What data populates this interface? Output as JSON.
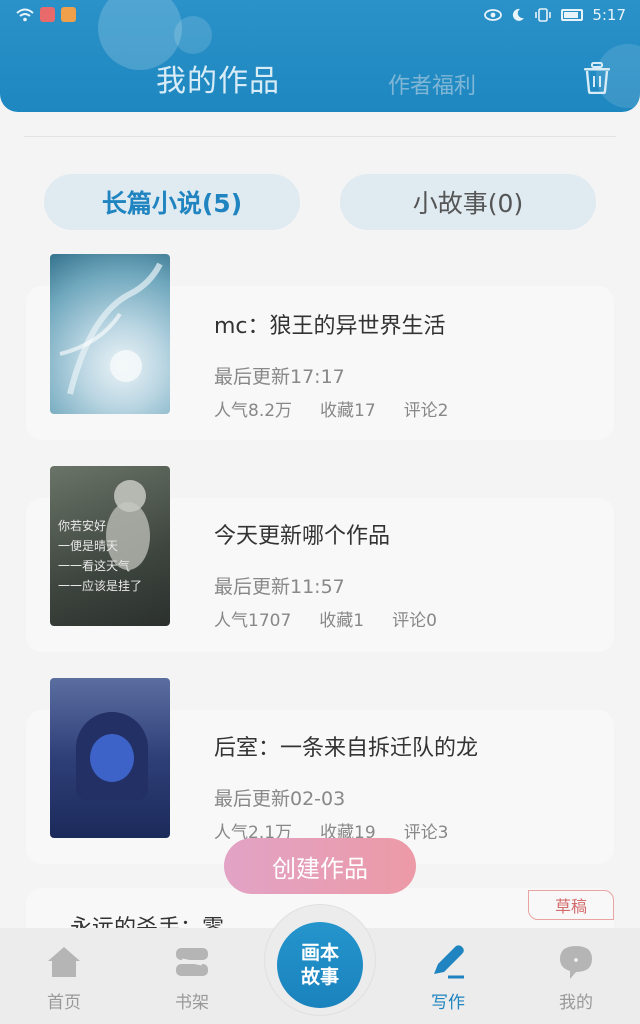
{
  "status_bar": {
    "time": "5:17"
  },
  "header": {
    "tab_my_works": "我的作品",
    "tab_author_welfare": "作者福利"
  },
  "segments": {
    "novel": "长篇小说(5)",
    "story": "小故事(0)"
  },
  "works": [
    {
      "title": "mc：狼王的异世界生活",
      "updated": "最后更新17:17",
      "popularity": "人气8.2万",
      "favorites": "收藏17",
      "comments": "评论2"
    },
    {
      "title": "今天更新哪个作品",
      "updated": "最后更新11:57",
      "popularity": "人气1707",
      "favorites": "收藏1",
      "comments": "评论0"
    },
    {
      "title": "后室：一条来自拆迁队的龙",
      "updated": "最后更新02-03",
      "popularity": "人气2.1万",
      "favorites": "收藏19",
      "comments": "评论3"
    }
  ],
  "cover2_text": [
    "你若安好",
    "一便是晴天",
    "一一看这天气",
    "一一应该是挂了"
  ],
  "draft": {
    "title": "永远的杀手：零",
    "badge": "草稿"
  },
  "create_button": "创建作品",
  "bottom_nav": {
    "home": "首页",
    "shelf": "书架",
    "center_line1": "画本",
    "center_line2": "故事",
    "write": "写作",
    "mine": "我的"
  },
  "colors": {
    "accent": "#1f84c0",
    "header": "#2a92c8",
    "create_gradient_start": "#e2a3c6",
    "create_gradient_end": "#ec9aa6"
  }
}
